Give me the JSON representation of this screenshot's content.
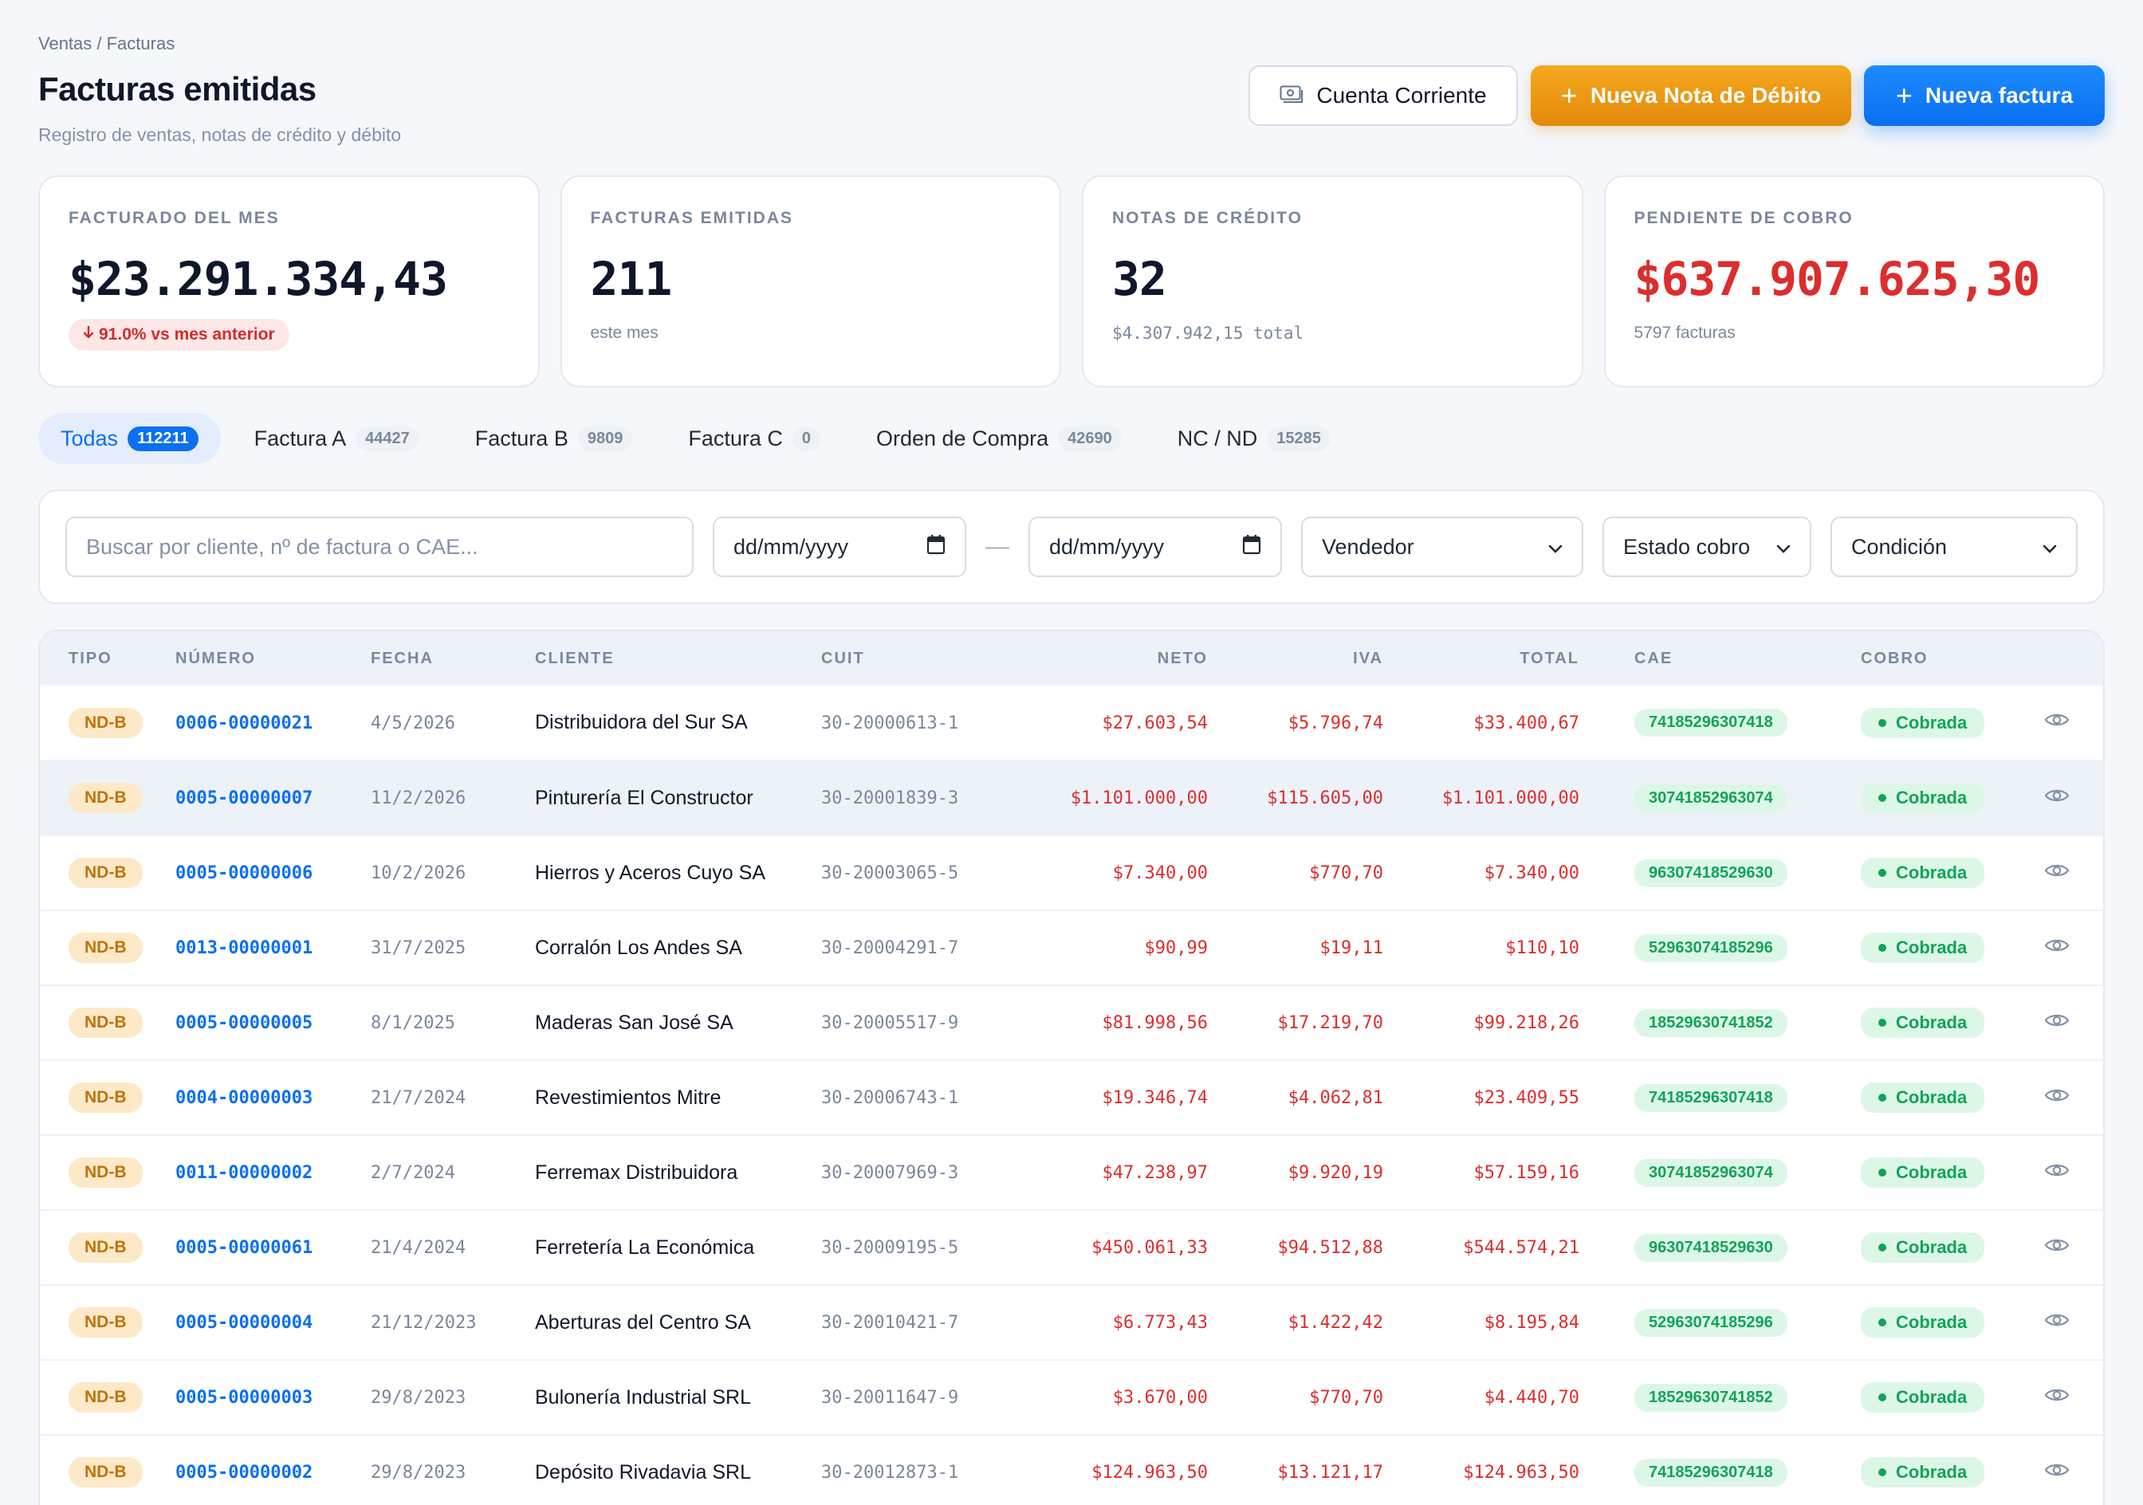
{
  "header": {
    "breadcrumb": "Ventas / Facturas",
    "title": "Facturas emitidas",
    "subtitle": "Registro de ventas, notas de crédito y débito"
  },
  "actions": {
    "cuenta_corriente": "Cuenta Corriente",
    "nueva_nota_debito": "Nueva Nota de Débito",
    "nueva_factura": "Nueva factura"
  },
  "kpis": {
    "facturado": {
      "label": "FACTURADO DEL MES",
      "value": "$23.291.334,43",
      "badge": "91.0% vs mes anterior"
    },
    "emitidas": {
      "label": "FACTURAS EMITIDAS",
      "value": "211",
      "sub": "este mes"
    },
    "notas": {
      "label": "NOTAS DE CRÉDITO",
      "value": "32",
      "sub": "$4.307.942,15 total"
    },
    "pendiente": {
      "label": "PENDIENTE DE COBRO",
      "value": "$637.907.625,30",
      "sub": "5797 facturas"
    }
  },
  "tabs": [
    {
      "label": "Todas",
      "count": "112211"
    },
    {
      "label": "Factura A",
      "count": "44427"
    },
    {
      "label": "Factura B",
      "count": "9809"
    },
    {
      "label": "Factura C",
      "count": "0"
    },
    {
      "label": "Orden de Compra",
      "count": "42690"
    },
    {
      "label": "NC / ND",
      "count": "15285"
    }
  ],
  "filters": {
    "search_placeholder": "Buscar por cliente, nº de factura o CAE...",
    "date_from": "dd/mm/yyyy",
    "date_to": "dd/mm/yyyy",
    "separator": "—",
    "vendedor": "Vendedor",
    "estado": "Estado cobro",
    "condicion": "Condición"
  },
  "table": {
    "headers": [
      "TIPO",
      "NÚMERO",
      "FECHA",
      "CLIENTE",
      "CUIT",
      "NETO",
      "IVA",
      "TOTAL",
      "CAE",
      "COBRO"
    ],
    "rows": [
      {
        "tipo": "ND-B",
        "numero": "0006-00000021",
        "fecha": "4/5/2026",
        "cliente": "Distribuidora del Sur SA",
        "cuit": "30-20000613-1",
        "neto": "$27.603,54",
        "iva": "$5.796,74",
        "total": "$33.400,67",
        "cae": "74185296307418",
        "cobro": "Cobrada"
      },
      {
        "tipo": "ND-B",
        "numero": "0005-00000007",
        "fecha": "11/2/2026",
        "cliente": "Pinturería El Constructor",
        "cuit": "30-20001839-3",
        "neto": "$1.101.000,00",
        "iva": "$115.605,00",
        "total": "$1.101.000,00",
        "cae": "30741852963074",
        "cobro": "Cobrada"
      },
      {
        "tipo": "ND-B",
        "numero": "0005-00000006",
        "fecha": "10/2/2026",
        "cliente": "Hierros y Aceros Cuyo SA",
        "cuit": "30-20003065-5",
        "neto": "$7.340,00",
        "iva": "$770,70",
        "total": "$7.340,00",
        "cae": "96307418529630",
        "cobro": "Cobrada"
      },
      {
        "tipo": "ND-B",
        "numero": "0013-00000001",
        "fecha": "31/7/2025",
        "cliente": "Corralón Los Andes SA",
        "cuit": "30-20004291-7",
        "neto": "$90,99",
        "iva": "$19,11",
        "total": "$110,10",
        "cae": "52963074185296",
        "cobro": "Cobrada"
      },
      {
        "tipo": "ND-B",
        "numero": "0005-00000005",
        "fecha": "8/1/2025",
        "cliente": "Maderas San José SA",
        "cuit": "30-20005517-9",
        "neto": "$81.998,56",
        "iva": "$17.219,70",
        "total": "$99.218,26",
        "cae": "18529630741852",
        "cobro": "Cobrada"
      },
      {
        "tipo": "ND-B",
        "numero": "0004-00000003",
        "fecha": "21/7/2024",
        "cliente": "Revestimientos Mitre",
        "cuit": "30-20006743-1",
        "neto": "$19.346,74",
        "iva": "$4.062,81",
        "total": "$23.409,55",
        "cae": "74185296307418",
        "cobro": "Cobrada"
      },
      {
        "tipo": "ND-B",
        "numero": "0011-00000002",
        "fecha": "2/7/2024",
        "cliente": "Ferremax Distribuidora",
        "cuit": "30-20007969-3",
        "neto": "$47.238,97",
        "iva": "$9.920,19",
        "total": "$57.159,16",
        "cae": "30741852963074",
        "cobro": "Cobrada"
      },
      {
        "tipo": "ND-B",
        "numero": "0005-00000061",
        "fecha": "21/4/2024",
        "cliente": "Ferretería La Económica",
        "cuit": "30-20009195-5",
        "neto": "$450.061,33",
        "iva": "$94.512,88",
        "total": "$544.574,21",
        "cae": "96307418529630",
        "cobro": "Cobrada"
      },
      {
        "tipo": "ND-B",
        "numero": "0005-00000004",
        "fecha": "21/12/2023",
        "cliente": "Aberturas del Centro SA",
        "cuit": "30-20010421-7",
        "neto": "$6.773,43",
        "iva": "$1.422,42",
        "total": "$8.195,84",
        "cae": "52963074185296",
        "cobro": "Cobrada"
      },
      {
        "tipo": "ND-B",
        "numero": "0005-00000003",
        "fecha": "29/8/2023",
        "cliente": "Bulonería Industrial SRL",
        "cuit": "30-20011647-9",
        "neto": "$3.670,00",
        "iva": "$770,70",
        "total": "$4.440,70",
        "cae": "18529630741852",
        "cobro": "Cobrada"
      },
      {
        "tipo": "ND-B",
        "numero": "0005-00000002",
        "fecha": "29/8/2023",
        "cliente": "Depósito Rivadavia SRL",
        "cuit": "30-20012873-1",
        "neto": "$124.963,50",
        "iva": "$13.121,17",
        "total": "$124.963,50",
        "cae": "74185296307418",
        "cobro": "Cobrada"
      }
    ]
  },
  "colors": {
    "accent": "#0a6ff0",
    "orange": "#e38a0b",
    "danger": "#dc2e2e",
    "success": "#11a35a"
  },
  "icons": {
    "cuenta": "money-card-icon",
    "plus": "plus-icon",
    "down": "arrow-down-icon",
    "calendar": "calendar-icon",
    "chevron": "chevron-down-icon",
    "view": "eye-icon"
  }
}
